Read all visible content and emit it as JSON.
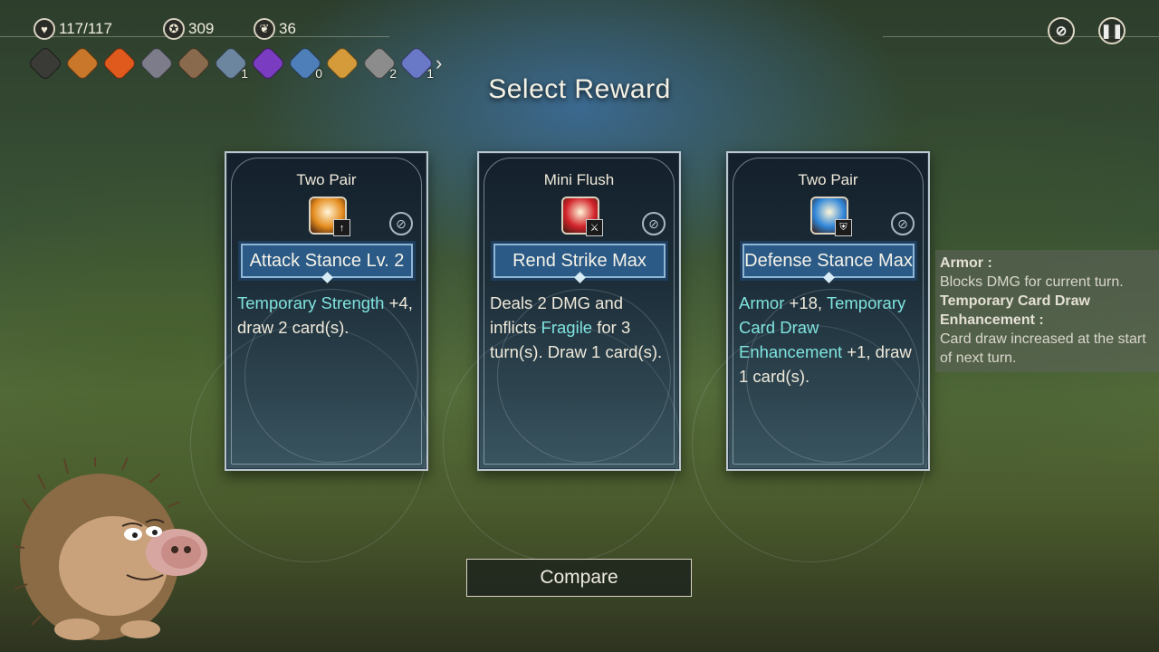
{
  "hud": {
    "hp": "117/117",
    "coins": "309",
    "shards": "36",
    "hp_icon": "heart-icon",
    "coin_icon": "coin-icon",
    "shard_icon": "shard-icon"
  },
  "relics": [
    {
      "icon": "spiral-icon",
      "count": "",
      "color": "#3a3a36"
    },
    {
      "icon": "spear-icon",
      "count": "",
      "color": "#c9772a"
    },
    {
      "icon": "potion-icon",
      "count": "",
      "color": "#e05a1e"
    },
    {
      "icon": "armor-icon",
      "count": "",
      "color": "#7c7c8a"
    },
    {
      "icon": "boot-icon",
      "count": "",
      "color": "#8a6a4c"
    },
    {
      "icon": "hammer-icon",
      "count": "1",
      "color": "#6c86a0"
    },
    {
      "icon": "orb-icon",
      "count": "",
      "color": "#7a3cc0"
    },
    {
      "icon": "helmet-icon",
      "count": "0",
      "color": "#4f7fb8"
    },
    {
      "icon": "ring-icon",
      "count": "",
      "color": "#d59a3a"
    },
    {
      "icon": "claw-icon",
      "count": "2",
      "color": "#8c8c8c"
    },
    {
      "icon": "glove-icon",
      "count": "1",
      "color": "#6a78c8"
    }
  ],
  "title": "Select Reward",
  "cards": [
    {
      "combo": "Two Pair",
      "name": "Attack Stance Lv. 2",
      "icon": "flame-icon",
      "icon_color": "#e58c1e",
      "badge": "↑",
      "desc_parts": [
        {
          "text": "Temporary Strength",
          "hl": true
        },
        {
          "text": " +4, draw 2 card(s).",
          "hl": false
        }
      ]
    },
    {
      "combo": "Mini Flush",
      "name": "Rend Strike Max",
      "icon": "claw-slash-icon",
      "icon_color": "#d2232a",
      "badge": "⚔",
      "desc_parts": [
        {
          "text": "Deals 2 DMG and inflicts ",
          "hl": false
        },
        {
          "text": "Fragile",
          "hl": true
        },
        {
          "text": " for 3 turn(s). Draw 1 card(s).",
          "hl": false
        }
      ]
    },
    {
      "combo": "Two Pair",
      "name": "Defense Stance Max",
      "icon": "shield-burst-icon",
      "icon_color": "#2f86d8",
      "badge": "⛨",
      "desc_parts": [
        {
          "text": "Armor",
          "hl": true
        },
        {
          "text": " +18, ",
          "hl": false
        },
        {
          "text": "Temporary Card Draw Enhancement",
          "hl": true
        },
        {
          "text": " +1, draw 1 card(s).",
          "hl": false
        }
      ]
    }
  ],
  "tooltip": [
    {
      "term": "Armor :",
      "def": "Blocks DMG for current turn."
    },
    {
      "term": "Temporary Card Draw Enhancement :",
      "def": "Card draw increased at the start of next turn."
    }
  ],
  "compare_label": "Compare",
  "colors": {
    "highlight": "#7fe3e0",
    "banner": "#2b5a86"
  }
}
